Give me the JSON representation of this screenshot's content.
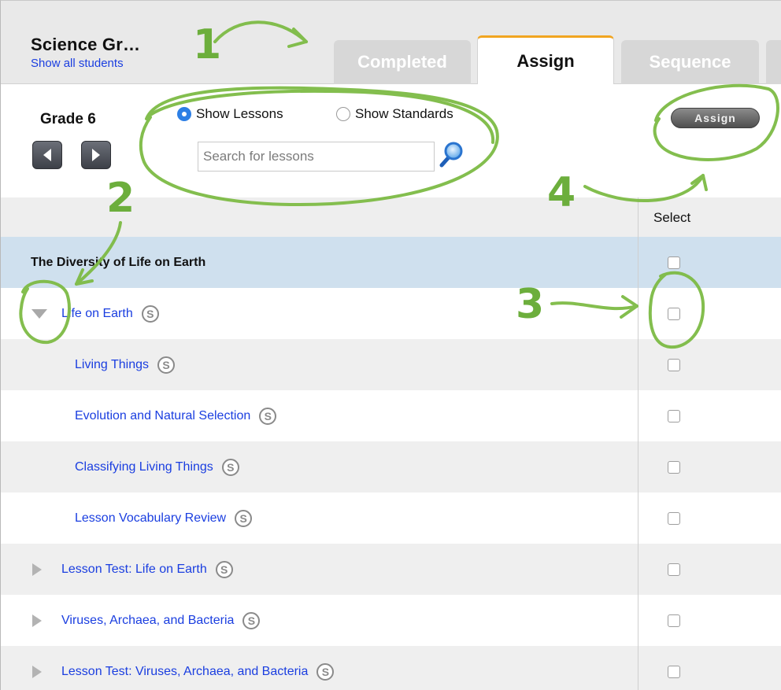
{
  "header": {
    "class_title": "Science Gr…",
    "show_all_link": "Show all students",
    "tabs": [
      {
        "label": "Completed",
        "active": false
      },
      {
        "label": "Assign",
        "active": true
      },
      {
        "label": "Sequence",
        "active": false
      }
    ],
    "active_tab_accent": "#f1a521"
  },
  "toolbar": {
    "grade_label": "Grade 6",
    "radio_lessons": "Show Lessons",
    "radio_standards": "Show Standards",
    "selected_view": "Show Lessons",
    "search_placeholder": "Search for lessons",
    "search_value": "",
    "assign_button": "Assign"
  },
  "table": {
    "select_header": "Select",
    "rows": [
      {
        "label": "The Diversity of Life on Earth",
        "badge": "",
        "kind": "unit",
        "checked": false
      },
      {
        "label": "Life on Earth",
        "badge": "S",
        "kind": "lesson-expanded",
        "checked": false
      },
      {
        "label": "Living Things",
        "badge": "S",
        "kind": "sub",
        "checked": false
      },
      {
        "label": "Evolution and Natural Selection",
        "badge": "S",
        "kind": "sub",
        "checked": false
      },
      {
        "label": "Classifying Living Things",
        "badge": "S",
        "kind": "sub",
        "checked": false
      },
      {
        "label": "Lesson Vocabulary Review",
        "badge": "S",
        "kind": "sub",
        "checked": false
      },
      {
        "label": "Lesson Test: Life on Earth",
        "badge": "S",
        "kind": "lesson-collapsed",
        "checked": false
      },
      {
        "label": "Viruses, Archaea, and Bacteria",
        "badge": "S",
        "kind": "lesson-collapsed",
        "checked": false
      },
      {
        "label": "Lesson Test: Viruses, Archaea, and Bacteria",
        "badge": "S",
        "kind": "lesson-collapsed",
        "checked": false
      }
    ]
  },
  "annotations": {
    "color": "#6cae3c",
    "numbers": [
      "1",
      "2",
      "3",
      "4"
    ]
  },
  "colors": {
    "link_blue": "#1a3ee0",
    "unit_row": "#cfe0ee",
    "radio_selected": "#2d7fe5"
  }
}
